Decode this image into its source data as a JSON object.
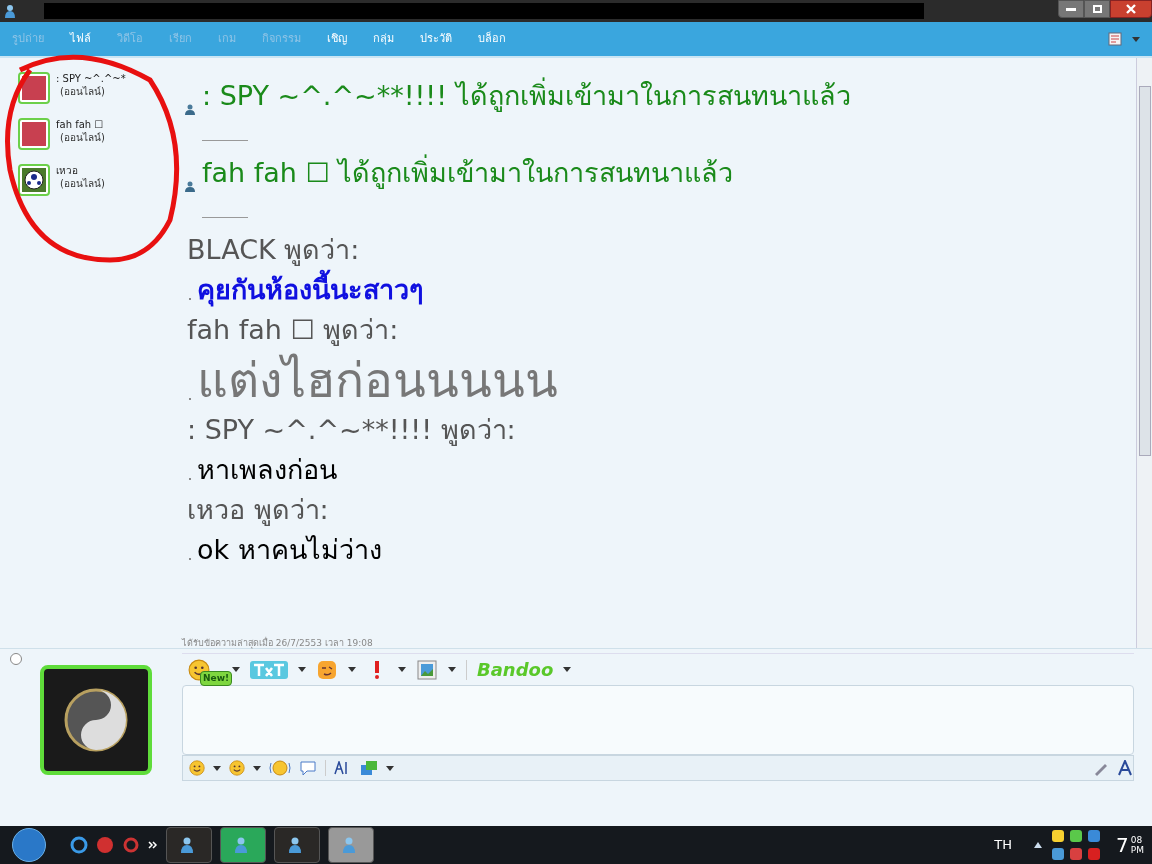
{
  "menu": [
    {
      "label": "รูปถ่าย",
      "disabled": true
    },
    {
      "label": "ไฟล์",
      "disabled": false
    },
    {
      "label": "วิดีโอ",
      "disabled": true
    },
    {
      "label": "เรียก",
      "disabled": true
    },
    {
      "label": "เกม",
      "disabled": true
    },
    {
      "label": "กิจกรรม",
      "disabled": true
    },
    {
      "label": "เชิญ",
      "disabled": false
    },
    {
      "label": "กลุ่ม",
      "disabled": false
    },
    {
      "label": "ประวัติ",
      "disabled": false
    },
    {
      "label": "บล็อก",
      "disabled": false
    }
  ],
  "contacts": [
    {
      "name": ": SPY ~^.^~*",
      "status": "(ออนไลน์)",
      "kind": "photo"
    },
    {
      "name": "fah fah ☐",
      "status": "(ออนไลน์)",
      "kind": "photo"
    },
    {
      "name": "เหวอ",
      "status": "(ออนไลน์)",
      "kind": "ball"
    }
  ],
  "messages": [
    {
      "kind": "system",
      "text": ": SPY ~^.^~**!!!! ได้ถูกเพิ่มเข้ามาในการสนทนาแล้ว"
    },
    {
      "kind": "system",
      "text": "fah fah ☐ ได้ถูกเพิ่มเข้ามาในการสนทนาแล้ว"
    },
    {
      "kind": "chat",
      "sender": "BLACK พูดว่า:",
      "text": "คุยกันห้องนี้นะสาวๆ",
      "color": "#1010e0"
    },
    {
      "kind": "large_chat",
      "sender": "fah fah ☐ พูดว่า:",
      "text": "แต่งไฮก่อนนนนน",
      "color": "#777777"
    },
    {
      "kind": "chat",
      "sender": ": SPY ~^.^~**!!!! พูดว่า:",
      "text": "หาเพลงก่อน",
      "color": "#000000"
    },
    {
      "kind": "chat",
      "sender": "เหวอ พูดว่า:",
      "text": "ok หาคนไม่ว่าง",
      "color": "#000000"
    }
  ],
  "last_received": "ได้รับข้อความล่าสุดเมื่อ 26/7/2553 เวลา 19:08",
  "new_badge": "New!",
  "bandoo": "Bandoo",
  "taskbar": {
    "language": "TH",
    "hour": "7",
    "minutes": "08",
    "ampm": "PM"
  }
}
